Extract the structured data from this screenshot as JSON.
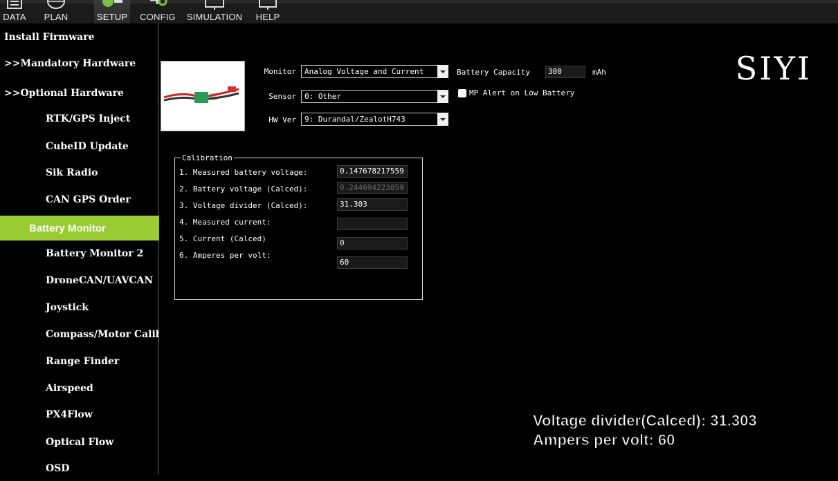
{
  "toolbar": {
    "items": [
      {
        "label": "DATA",
        "icon": "monitor-icon"
      },
      {
        "label": "PLAN",
        "icon": "globe-icon"
      },
      {
        "label": "SETUP",
        "icon": "setup-icon",
        "active": true
      },
      {
        "label": "CONFIG",
        "icon": "wrench-icon"
      },
      {
        "label": "SIMULATION",
        "icon": "simulation-icon"
      },
      {
        "label": "HELP",
        "icon": "help-icon"
      }
    ]
  },
  "sidebar": {
    "items": [
      {
        "label": "Install Firmware"
      },
      {
        "label": ">>Mandatory Hardware"
      },
      {
        "label": ">>Optional Hardware"
      },
      {
        "label": "RTK/GPS Inject"
      },
      {
        "label": "CubeID Update"
      },
      {
        "label": "Sik Radio"
      },
      {
        "label": "CAN GPS Order"
      },
      {
        "label": "Battery Monitor"
      },
      {
        "label": "Battery Monitor 2"
      },
      {
        "label": "DroneCAN/UAVCAN"
      },
      {
        "label": "Joystick"
      },
      {
        "label": "Compass/Motor Calib"
      },
      {
        "label": "Range Finder"
      },
      {
        "label": "Airspeed"
      },
      {
        "label": "PX4Flow"
      },
      {
        "label": "Optical Flow"
      },
      {
        "label": "OSD"
      }
    ],
    "active_index": 7,
    "active_color": "#99cc33"
  },
  "logo": "SIYI",
  "settings": {
    "monitor_label": "Monitor",
    "monitor_value": "Analog Voltage and Current",
    "sensor_label": "Sensor",
    "sensor_value": "0: Other",
    "hwver_label": "HW Ver",
    "hwver_value": "9: Durandal/ZealotH743",
    "capacity_label": "Battery Capacity",
    "capacity_value": "300",
    "capacity_unit": "mAh",
    "alert_label": "MP Alert on Low Battery"
  },
  "calibration": {
    "title": "Calibration",
    "rows": [
      {
        "label": "1. Measured battery voltage:",
        "value": "0.147678217559",
        "disabled": false
      },
      {
        "label": "2. Battery voltage (Calced):",
        "value": "0.244694223859",
        "disabled": true
      },
      {
        "label": "3. Voltage divider (Calced):",
        "value": "31.303",
        "disabled": false
      },
      {
        "label": "4. Measured current:",
        "value": "",
        "disabled": false
      },
      {
        "label": "5. Current (Calced)",
        "value": "0",
        "disabled": false
      },
      {
        "label": "6. Amperes per volt:",
        "value": "60",
        "disabled": false
      }
    ]
  },
  "overlay": {
    "line1": "Voltage divider(Calced): 31.303",
    "line2": "Ampers per volt: 60"
  }
}
